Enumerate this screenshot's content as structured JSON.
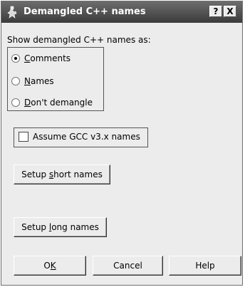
{
  "window": {
    "title": "Demangled C++ names",
    "help_button": "?",
    "close_button": "X"
  },
  "prompt": "Show demangled C++ names as:",
  "options": {
    "selected": "Comments",
    "items": [
      {
        "pre": "",
        "key": "C",
        "post": "omments",
        "checked": true
      },
      {
        "pre": "",
        "key": "N",
        "post": "ames",
        "checked": false
      },
      {
        "pre": "",
        "key": "D",
        "post": "on't demangle",
        "checked": false
      }
    ]
  },
  "checkbox": {
    "label": "Assume GCC v3.x names",
    "checked": false
  },
  "buttons": {
    "setup_short": {
      "pre": "Setup ",
      "key": "s",
      "post": "hort names"
    },
    "setup_long": {
      "pre": "Setup ",
      "key": "l",
      "post": "ong  names"
    },
    "ok": {
      "pre": "O",
      "key": "K",
      "post": ""
    },
    "cancel": "Cancel",
    "help": "Help"
  }
}
